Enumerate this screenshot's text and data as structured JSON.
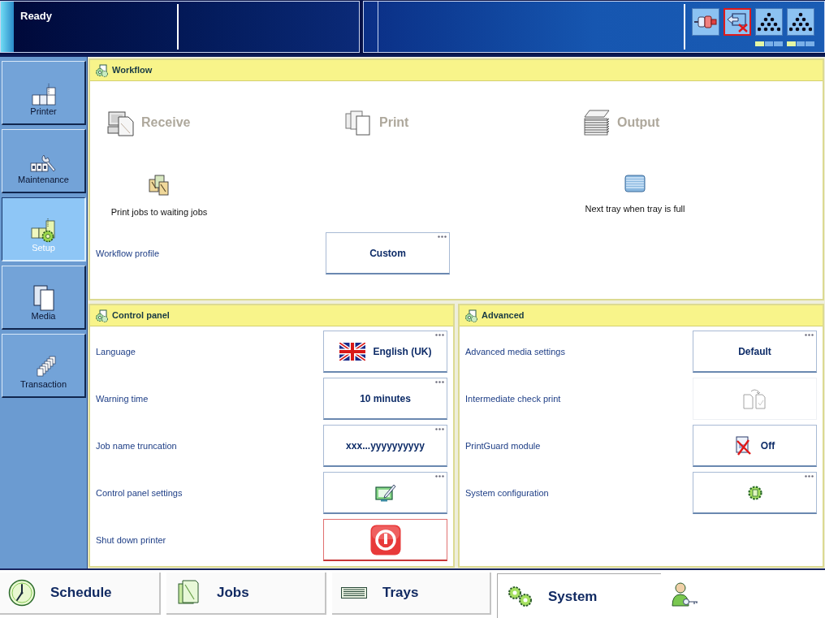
{
  "top_bar": {
    "status": "Ready",
    "devices": [
      {
        "kind": "connector",
        "alert": false
      },
      {
        "kind": "output",
        "alert": true
      },
      {
        "kind": "stacker",
        "alert": false,
        "level": 0.33
      },
      {
        "kind": "stacker",
        "alert": false,
        "level": 0.33
      }
    ]
  },
  "sidebar": {
    "items": [
      {
        "label": "Printer",
        "selected": false
      },
      {
        "label": "Maintenance",
        "selected": false
      },
      {
        "label": "Setup",
        "selected": true
      },
      {
        "label": "Media",
        "selected": false
      },
      {
        "label": "Transaction",
        "selected": false
      }
    ]
  },
  "workflow": {
    "title": "Workflow",
    "steps": [
      {
        "label": "Receive",
        "setting": "Print jobs to waiting jobs"
      },
      {
        "label": "Print"
      },
      {
        "label": "Output",
        "setting": "Next tray when tray is full"
      }
    ],
    "profile": {
      "label": "Workflow profile",
      "value": "Custom",
      "more": true
    }
  },
  "control_panel": {
    "title": "Control panel",
    "rows": [
      {
        "label": "Language",
        "kind": "language",
        "value": "English (UK)",
        "more": true,
        "disabled": false
      },
      {
        "label": "Warning time",
        "kind": "text",
        "value": "10 minutes",
        "more": true,
        "disabled": false
      },
      {
        "label": "Job name truncation",
        "kind": "text",
        "value": "xxx...yyyyyyyyyy",
        "more": true,
        "disabled": false
      },
      {
        "label": "Control panel settings",
        "kind": "edit",
        "more": true,
        "disabled": false
      },
      {
        "label": "Shut down printer",
        "kind": "power",
        "more": false,
        "disabled": false
      }
    ]
  },
  "advanced": {
    "title": "Advanced",
    "rows": [
      {
        "label": "Advanced media settings",
        "kind": "text",
        "value": "Default",
        "more": true,
        "disabled": false
      },
      {
        "label": "Intermediate check print",
        "kind": "check_print",
        "more": false,
        "disabled": true
      },
      {
        "label": "PrintGuard module",
        "kind": "guard",
        "value": "Off",
        "more": false,
        "disabled": false
      },
      {
        "label": "System configuration",
        "kind": "config",
        "more": true,
        "disabled": false
      }
    ]
  },
  "bottom_tabs": [
    {
      "label": "Schedule",
      "selected": false
    },
    {
      "label": "Jobs",
      "selected": false
    },
    {
      "label": "Trays",
      "selected": false
    },
    {
      "label": "System",
      "selected": true
    }
  ]
}
